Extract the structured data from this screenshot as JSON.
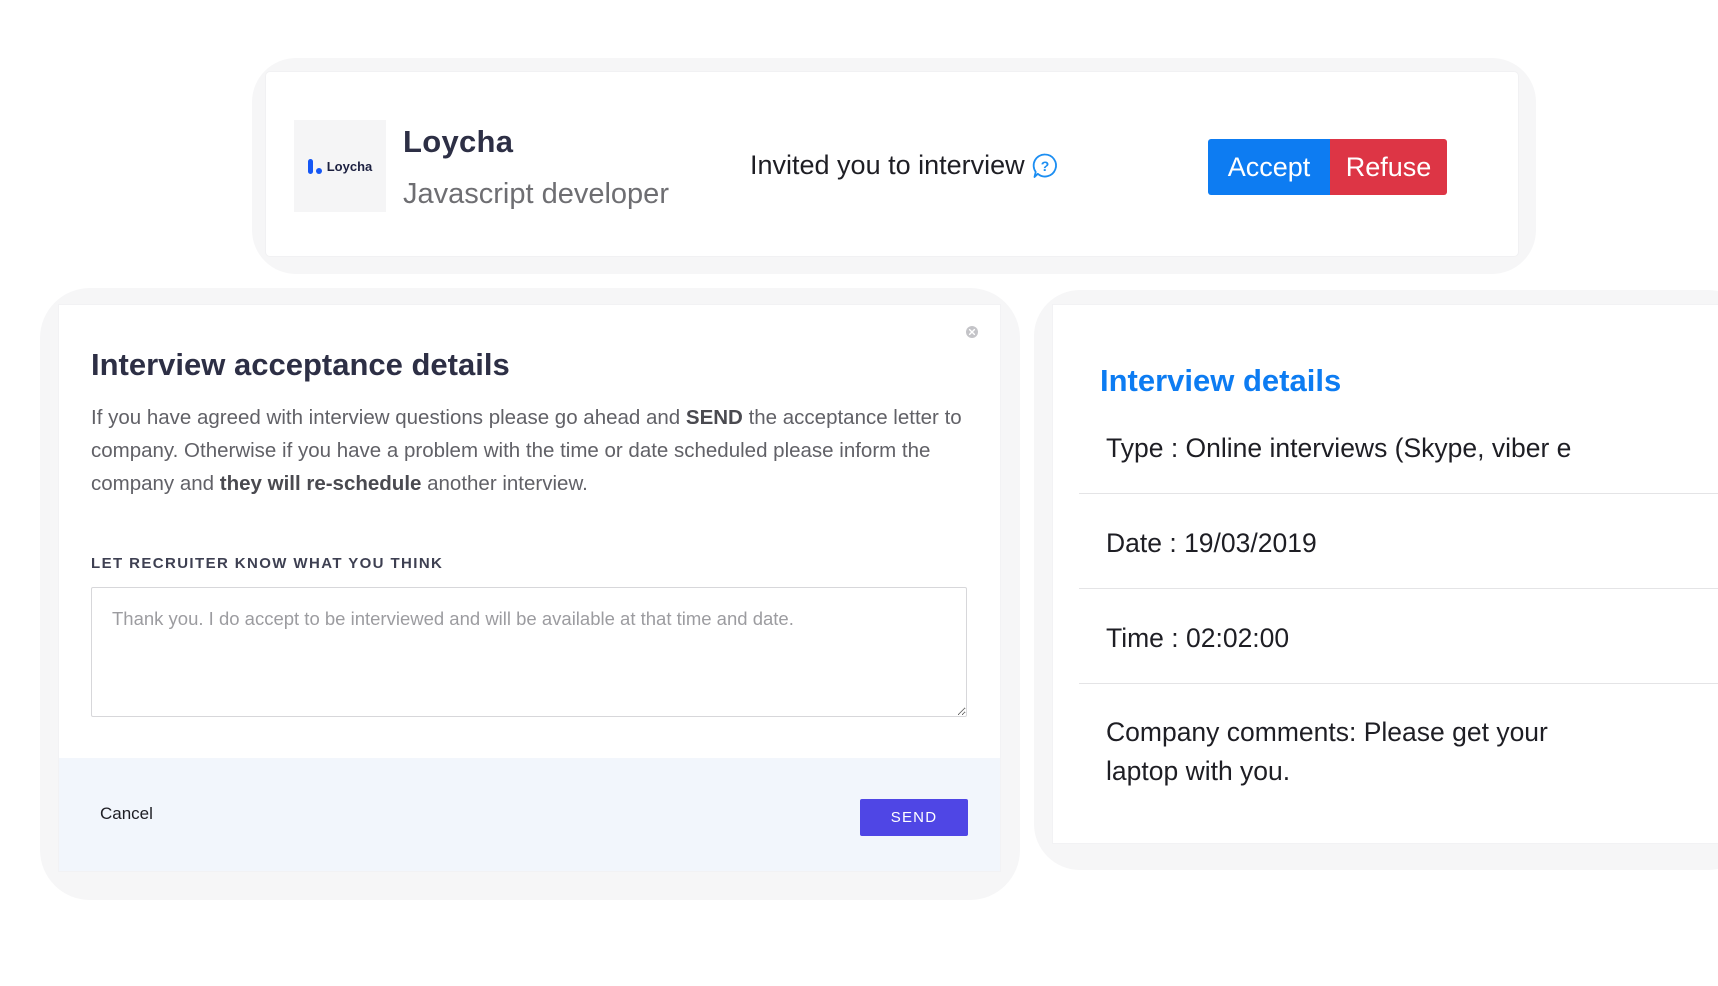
{
  "invitation": {
    "logo_text": "Loycha",
    "company_name": "Loycha",
    "job_title": "Javascript developer",
    "message": "Invited you to interview",
    "accept_label": "Accept",
    "refuse_label": "Refuse"
  },
  "modal": {
    "title": "Interview acceptance details",
    "description": {
      "part1": "If you have agreed with interview questions please go ahead and ",
      "bold1": "SEND",
      "part2": " the acceptance letter to company. Otherwise if you have a problem with the time or date scheduled please inform the company and ",
      "bold2": "they will re-schedule",
      "part3": " another interview."
    },
    "field_label": "LET RECRUITER KNOW WHAT YOU THINK",
    "comment_placeholder": "Thank you. I do accept to be interviewed and will be available at that time and date.",
    "comment_value": "",
    "cancel_label": "Cancel",
    "send_label": "SEND"
  },
  "details": {
    "title": "Interview details",
    "type": "Type : Online interviews (Skype, viber e",
    "date": "Date : 19/03/2019",
    "time": "Time : 02:02:00",
    "comments": "Company comments: Please get your laptop with you."
  },
  "colors": {
    "accent_blue": "#0d7cf2",
    "refuse_red": "#dd3545",
    "send_indigo": "#4f46e5",
    "footer_bg": "#f2f6fc"
  }
}
